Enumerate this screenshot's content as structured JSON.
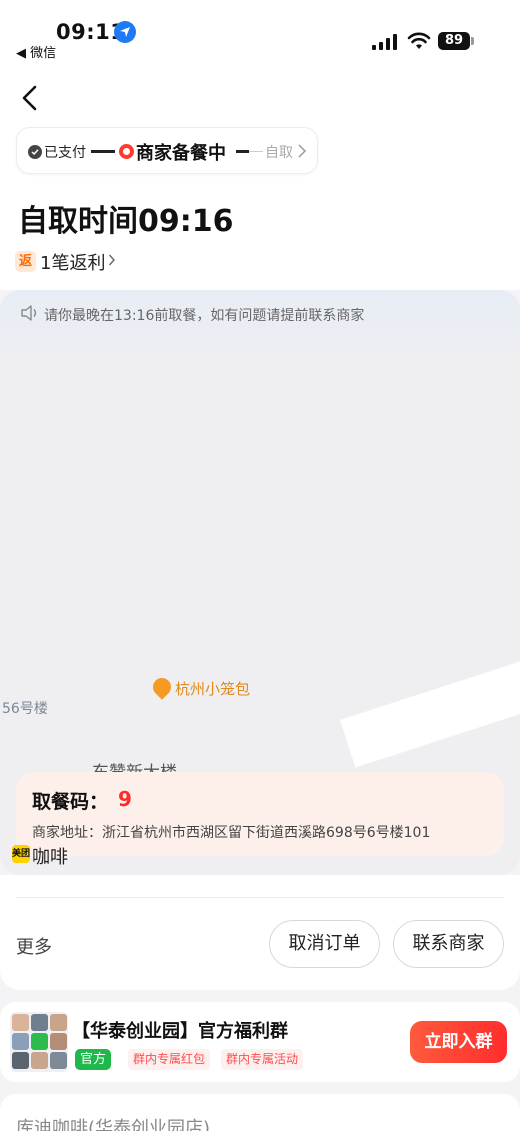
{
  "status_bar": {
    "time": "09:11",
    "back_app": "◀ 微信",
    "battery": "89"
  },
  "header": {
    "progress": {
      "paid": "已支付",
      "preparing": "商家备餐中",
      "pickup": "自取"
    },
    "pickup_time": "自取时间09:16",
    "rebate_badge": "返",
    "rebate_text": "1笔返利"
  },
  "map": {
    "notice": "请你最晚在13:16前取餐，如有问题请提前联系商家",
    "poi_label": "杭州小笼包",
    "building_label": "56号楼",
    "partial_label": "东赞新大楼",
    "bottom_partial": "咖啡",
    "meituan_mark": "美团",
    "code_label": "取餐码：",
    "code_value": "9",
    "address": "商家地址：浙江省杭州市西湖区留下街道西溪路698号6号楼101"
  },
  "actions": {
    "more": "更多",
    "cancel": "取消订单",
    "contact": "联系商家"
  },
  "group": {
    "title": "【华泰创业园】官方福利群",
    "official": "官方",
    "tag1": "群内专属红包",
    "tag2": "群内专属活动",
    "join": "立即入群"
  },
  "store": {
    "name": "库迪咖啡(华泰创业园店)"
  },
  "colors": {
    "accent_red": "#ff2a2a",
    "join_button": "#ff3b30",
    "official_green": "#1fb84a",
    "rebate_orange": "#ff6a00"
  }
}
